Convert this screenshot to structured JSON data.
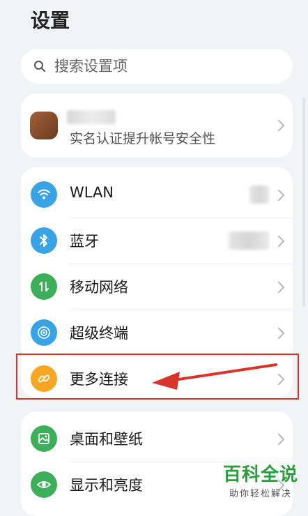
{
  "header": {
    "title": "设置"
  },
  "search": {
    "placeholder": "搜索设置项"
  },
  "account": {
    "description": "实名认证提升帐号安全性"
  },
  "network_items": [
    {
      "label": "WLAN",
      "icon": "wifi-icon",
      "color": "#3aa3e6"
    },
    {
      "label": "蓝牙",
      "icon": "bluetooth-icon",
      "color": "#3aa3e6"
    },
    {
      "label": "移动网络",
      "icon": "mobile-data-icon",
      "color": "#3dae5a"
    },
    {
      "label": "超级终端",
      "icon": "super-device-icon",
      "color": "#3aa3e6"
    },
    {
      "label": "更多连接",
      "icon": "link-icon",
      "color": "#f5a623"
    }
  ],
  "display_items": [
    {
      "label": "桌面和壁纸",
      "icon": "wallpaper-icon",
      "color": "#3dae5a"
    },
    {
      "label": "显示和亮度",
      "icon": "eye-icon",
      "color": "#3dae5a"
    }
  ],
  "watermark": {
    "title": "百科全说",
    "subtitle": "助你轻松解决"
  },
  "colors": {
    "highlight": "#d9342b",
    "background": "#f1f3f5"
  }
}
